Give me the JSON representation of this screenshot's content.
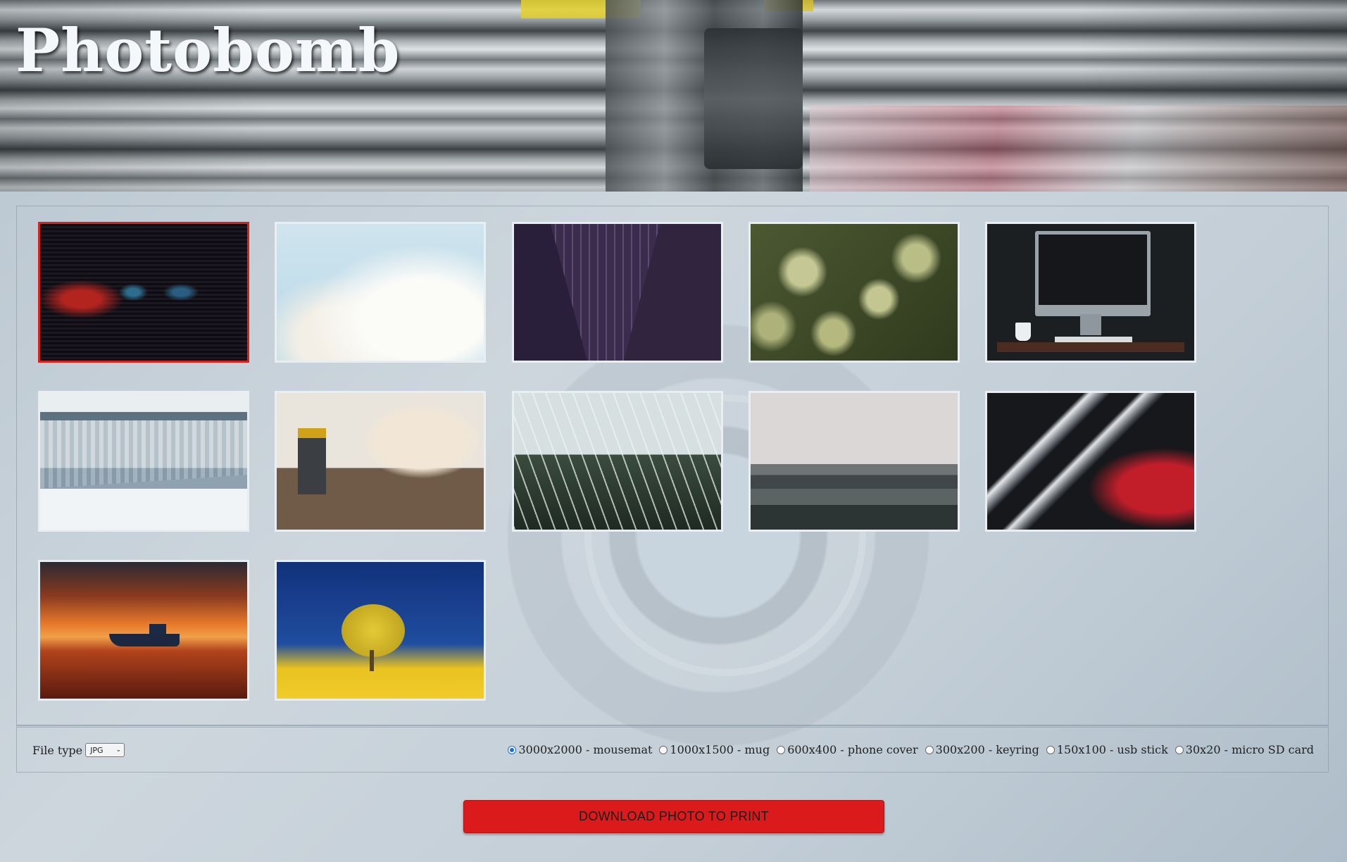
{
  "header": {
    "title": "Photobomb"
  },
  "gallery": {
    "photos": [
      {
        "id": 1,
        "subject": "dark red and blue light blinds",
        "selected": true
      },
      {
        "id": 2,
        "subject": "white magnolia blossoms"
      },
      {
        "id": 3,
        "subject": "purple city skyscrapers at night"
      },
      {
        "id": 4,
        "subject": "green succulent plants"
      },
      {
        "id": 5,
        "subject": "desktop computer on desk"
      },
      {
        "id": 6,
        "subject": "frozen waterfall"
      },
      {
        "id": 7,
        "subject": "woodworking tools and guitar bodies"
      },
      {
        "id": 8,
        "subject": "glasshouse interior with plants"
      },
      {
        "id": 9,
        "subject": "misty coastline"
      },
      {
        "id": 10,
        "subject": "red and chrome abstract shapes"
      },
      {
        "id": 11,
        "subject": "boat at sunset"
      },
      {
        "id": 12,
        "subject": "yellow tree under blue sky"
      }
    ]
  },
  "options": {
    "filetype_label": "File type",
    "filetype_selected": "JPG",
    "sizes": [
      {
        "label": "3000x2000 - mousemat",
        "checked": true
      },
      {
        "label": "1000x1500 - mug",
        "checked": false
      },
      {
        "label": "600x400 - phone cover",
        "checked": false
      },
      {
        "label": "300x200 - keyring",
        "checked": false
      },
      {
        "label": "150x100 - usb stick",
        "checked": false
      },
      {
        "label": "30x20 - micro SD card",
        "checked": false
      }
    ]
  },
  "download": {
    "label": "DOWNLOAD PHOTO TO PRINT"
  },
  "colors": {
    "accent": "#db1b1b",
    "selected_border": "#d6231d",
    "radio_checked": "#1a6fd6"
  }
}
